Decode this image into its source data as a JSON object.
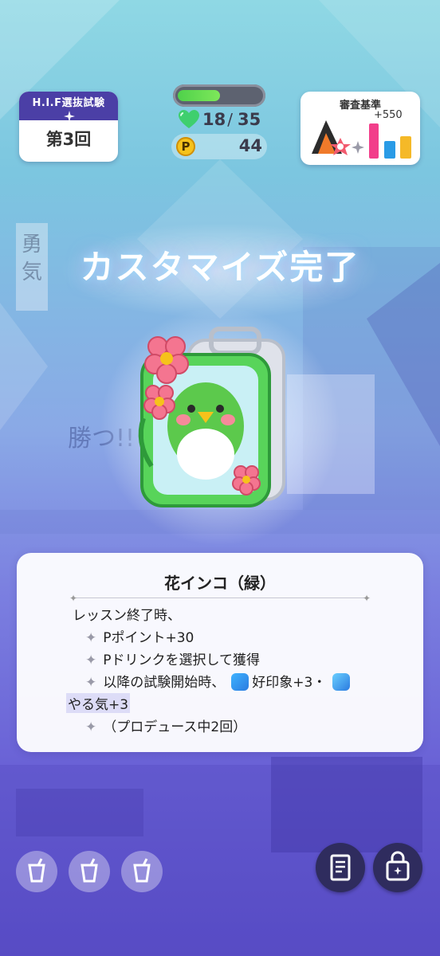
{
  "status": {
    "exam_name": "H.I.F選抜試験",
    "round": "第3回",
    "hp_current": "18",
    "hp_max": "35",
    "hp_fraction": 0.51,
    "points": "44",
    "point_icon": "P"
  },
  "criteria": {
    "title": "審査基準",
    "bonus": "+550"
  },
  "headline": "カスタマイズ完了",
  "item": {
    "name": "花インコ（緑）",
    "trigger": "レッスン終了時、",
    "effects": [
      "Pポイント+30",
      "Pドリンクを選択して獲得",
      "以降の試験開始時、",
      "好印象+3・",
      "やる気+3",
      "（プロデュース中2回）"
    ]
  },
  "colors": {
    "exam_header": "#4b3fa6",
    "hp_fill": "#4fd14b",
    "button_dark": "#2f2c5e",
    "point_coin": "#f6c21b"
  },
  "icons": [
    "heart-icon",
    "point-coin-icon",
    "drink-slot-icon",
    "memo-icon",
    "customize-bag-icon",
    "good-impression-icon",
    "motivation-icon"
  ]
}
